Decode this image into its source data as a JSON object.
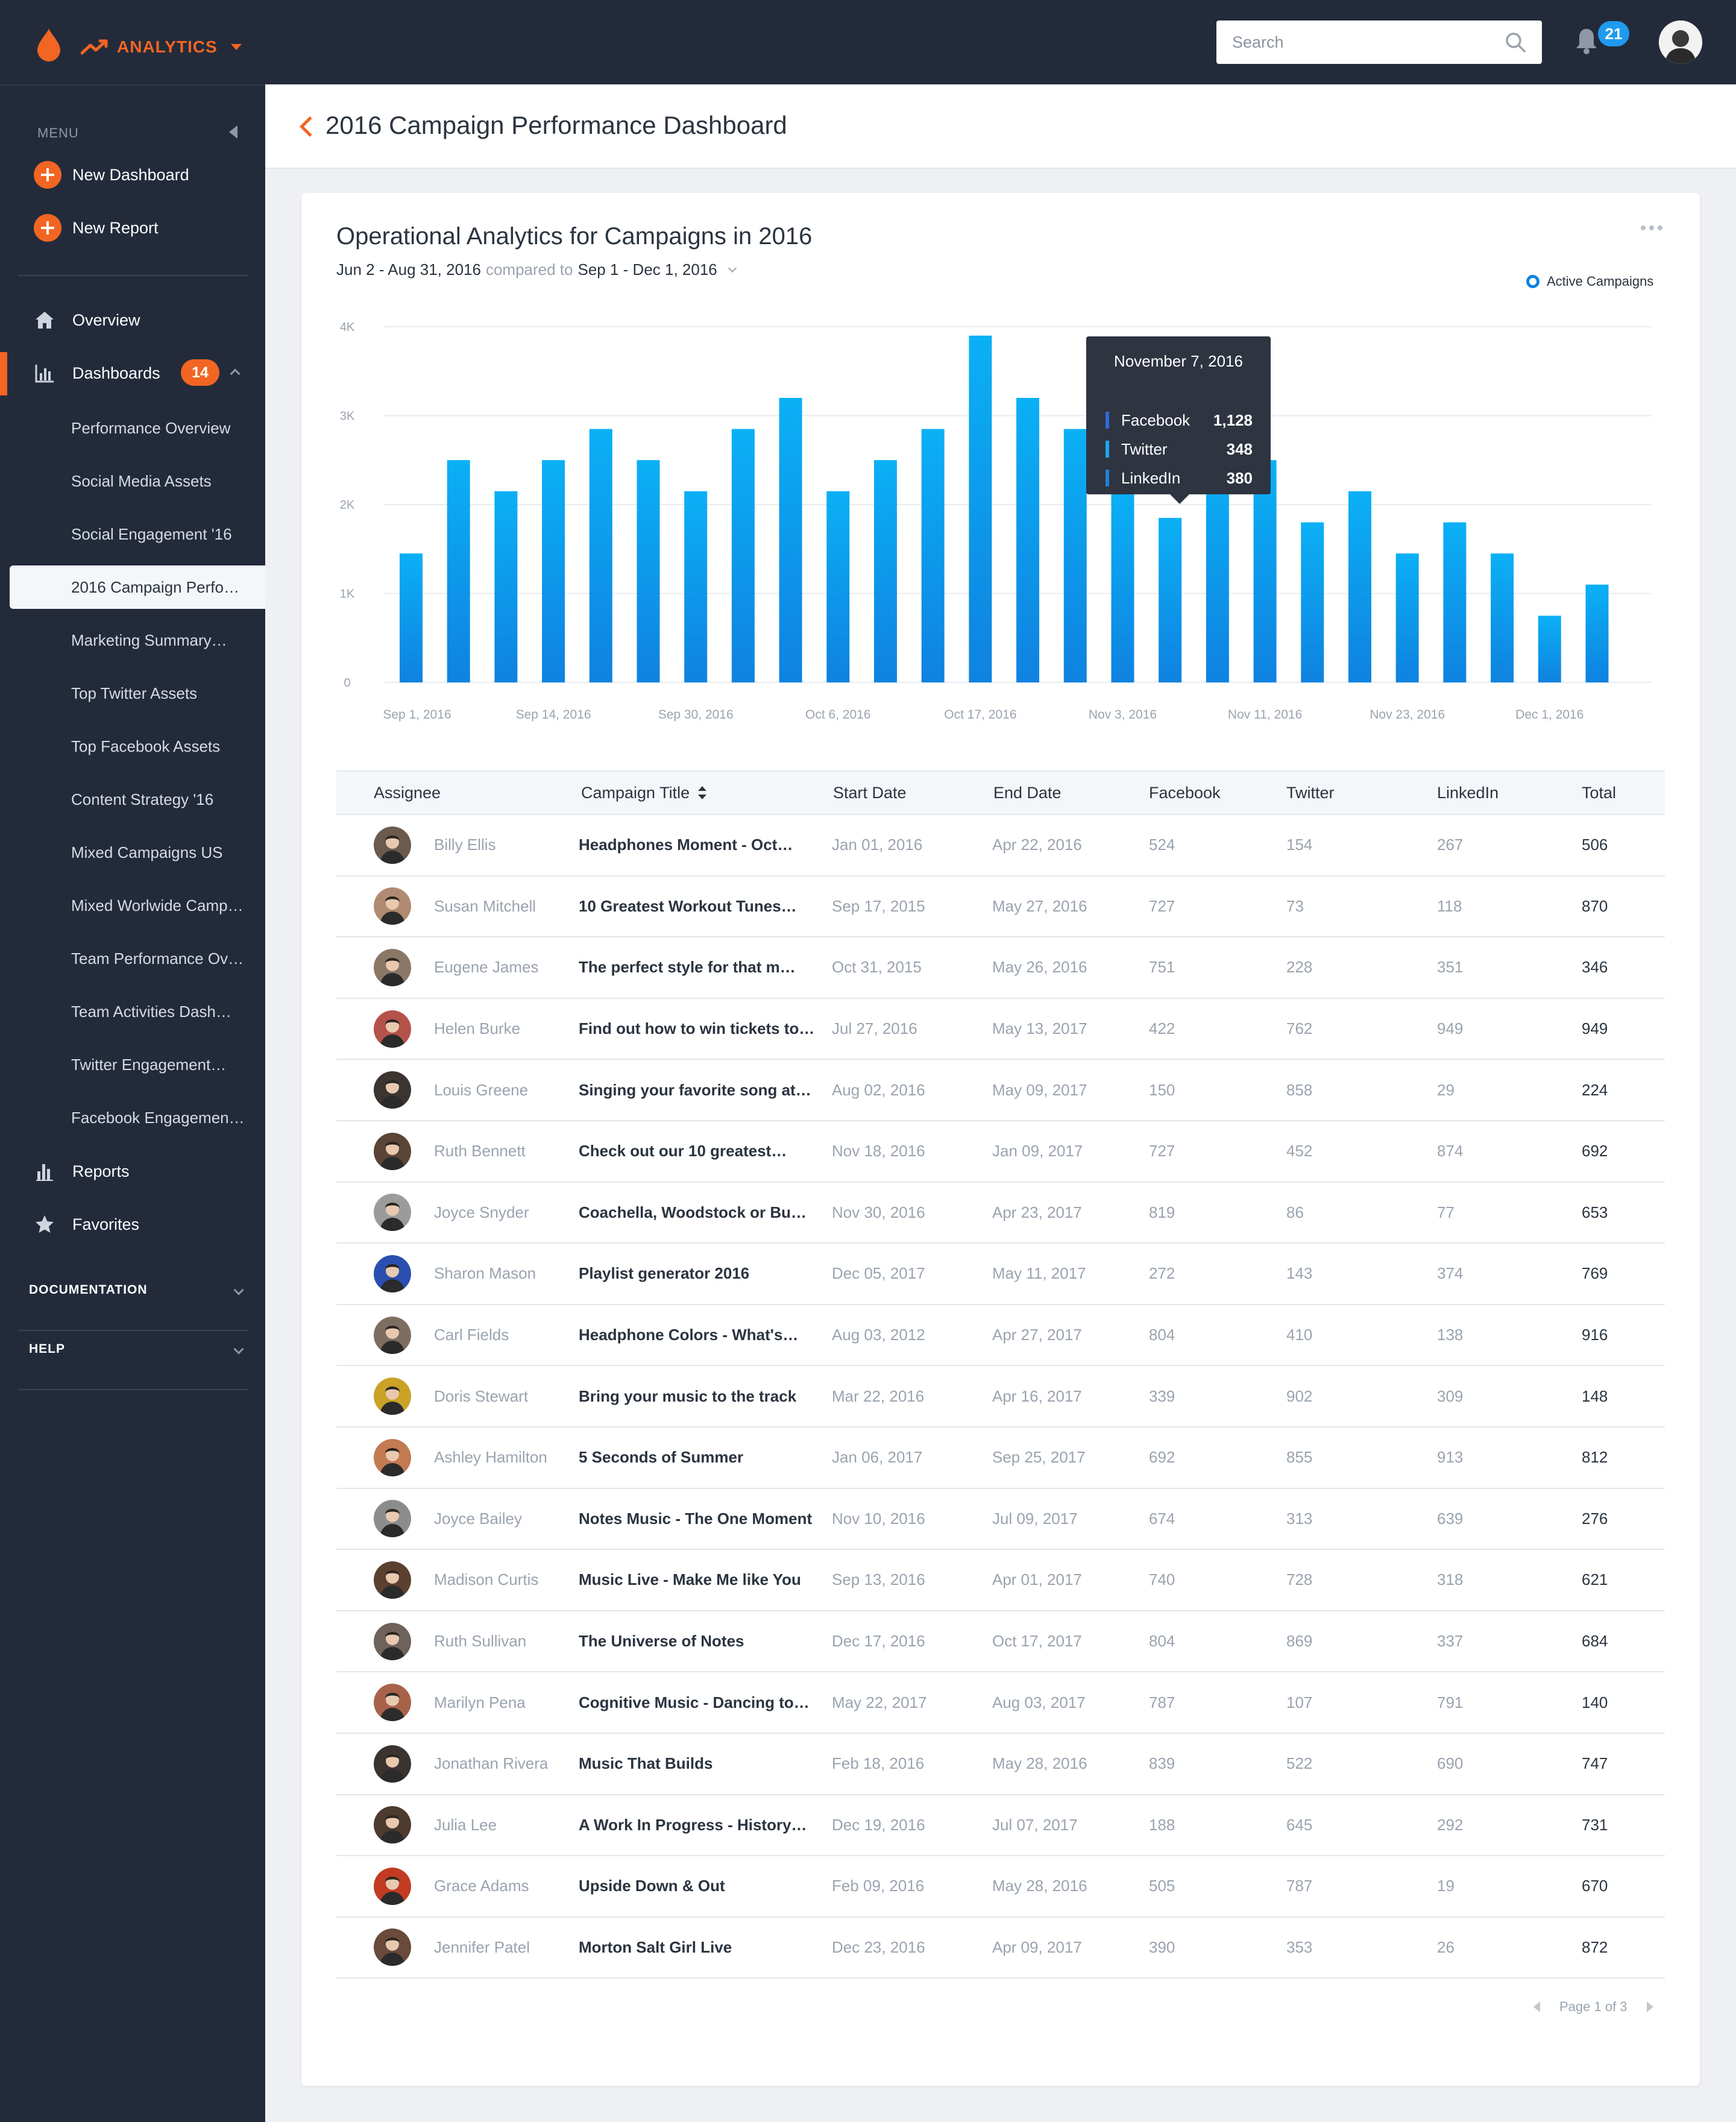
{
  "topbar": {
    "brand": "ANALYTICS",
    "search_placeholder": "Search",
    "notifications": "21"
  },
  "sidebar": {
    "menu_label": "MENU",
    "new_dashboard": "New Dashboard",
    "new_report": "New Report",
    "overview": "Overview",
    "dashboards": "Dashboards",
    "dashboards_count": "14",
    "dashboard_items": [
      "Performance Overview",
      "Social Media Assets",
      "Social Engagement '16",
      "2016 Campaign Perfo…",
      "Marketing Summary…",
      "Top Twitter Assets",
      "Top Facebook Assets",
      "Content Strategy '16",
      "Mixed Campaigns US",
      "Mixed Worlwide Camp…",
      "Team Performance Ov…",
      "Team Activities Dash…",
      "Twitter Engagement…",
      "Facebook Engagemen…"
    ],
    "active_item_index": 3,
    "reports": "Reports",
    "favorites": "Favorites",
    "documentation": "DOCUMENTATION",
    "help": "HELP"
  },
  "header": {
    "title": "2016 Campaign Performance Dashboard"
  },
  "card": {
    "title": "Operational Analytics for Campaigns in 2016",
    "range_primary": "Jun 2 - Aug 31, 2016",
    "compared_to": "compared to",
    "range_compare": "Sep 1 - Dec 1, 2016",
    "legend": "Active Campaigns"
  },
  "colors": {
    "accent": "#f26522",
    "bar_top": "#0bb0f5",
    "bar_bottom": "#0f82e0",
    "sidebar_bg": "#232b3b",
    "facebook": "#2e6bd6",
    "twitter": "#1ea6f0",
    "linkedin": "#1e82d6"
  },
  "chart_data": {
    "type": "bar",
    "y_ticks": [
      "0",
      "1K",
      "2K",
      "3K",
      "4K"
    ],
    "ylim": [
      0,
      4000
    ],
    "x_labels": [
      "Sep 1, 2016",
      "Sep 14, 2016",
      "Sep 30, 2016",
      "Oct 6, 2016",
      "Oct 17, 2016",
      "Nov 3, 2016",
      "Nov  11, 2016",
      "Nov 23, 2016",
      "Dec 1, 2016"
    ],
    "x_label_bar_index": [
      0,
      3,
      6,
      9,
      12,
      15,
      18,
      21,
      24
    ],
    "series": [
      {
        "name": "Active Campaigns",
        "values": [
          1450,
          2500,
          2150,
          2500,
          2850,
          2500,
          2150,
          2850,
          3200,
          2150,
          2500,
          2850,
          3900,
          3200,
          2850,
          2150,
          1850,
          2500,
          2500,
          1800,
          2150,
          1450,
          1800,
          1450,
          750,
          1100
        ]
      }
    ],
    "grid": true,
    "legend_position": "top-right",
    "tooltip": {
      "date": "November 7, 2016",
      "bar_index": 16,
      "rows": [
        {
          "name": "Facebook",
          "value": "1,128"
        },
        {
          "name": "Twitter",
          "value": "348"
        },
        {
          "name": "LinkedIn",
          "value": "380"
        }
      ]
    }
  },
  "table": {
    "headers": [
      "Assignee",
      "Campaign Title",
      "Start Date",
      "End Date",
      "Facebook",
      "Twitter",
      "LinkedIn",
      "Total"
    ],
    "rows": [
      {
        "assignee": "Billy Ellis",
        "title": "Headphones Moment - Oct…",
        "start": "Jan 01, 2016",
        "end": "Apr 22, 2016",
        "facebook": "524",
        "twitter": "154",
        "linkedin": "267",
        "total": "506",
        "avatar": "#6b5a4e"
      },
      {
        "assignee": "Susan Mitchell",
        "title": "10 Greatest Workout Tunes…",
        "start": "Sep 17, 2015",
        "end": "May 27, 2016",
        "facebook": "727",
        "twitter": "73",
        "linkedin": "118",
        "total": "870",
        "avatar": "#b08a72"
      },
      {
        "assignee": "Eugene James",
        "title": "The perfect style for that m…",
        "start": "Oct 31, 2015",
        "end": "May 26, 2016",
        "facebook": "751",
        "twitter": "228",
        "linkedin": "351",
        "total": "346",
        "avatar": "#8a7766"
      },
      {
        "assignee": "Helen Burke",
        "title": "Find out how to win tickets to…",
        "start": "Jul 27, 2016",
        "end": "May 13, 2017",
        "facebook": "422",
        "twitter": "762",
        "linkedin": "949",
        "total": "949",
        "avatar": "#b5524a"
      },
      {
        "assignee": "Louis Greene",
        "title": "Singing your favorite song at…",
        "start": "Aug 02, 2016",
        "end": "May 09, 2017",
        "facebook": "150",
        "twitter": "858",
        "linkedin": "29",
        "total": "224",
        "avatar": "#3c3431"
      },
      {
        "assignee": "Ruth Bennett",
        "title": "Check out our 10 greatest…",
        "start": "Nov 18, 2016",
        "end": "Jan 09, 2017",
        "facebook": "727",
        "twitter": "452",
        "linkedin": "874",
        "total": "692",
        "avatar": "#5a4436"
      },
      {
        "assignee": "Joyce Snyder",
        "title": "Coachella, Woodstock or Bu…",
        "start": "Nov 30, 2016",
        "end": "Apr 23, 2017",
        "facebook": "819",
        "twitter": "86",
        "linkedin": "77",
        "total": "653",
        "avatar": "#9b9b9b"
      },
      {
        "assignee": "Sharon Mason",
        "title": "Playlist generator 2016",
        "start": "Dec 05, 2017",
        "end": "May 11, 2017",
        "facebook": "272",
        "twitter": "143",
        "linkedin": "374",
        "total": "769",
        "avatar": "#2a4fb0"
      },
      {
        "assignee": "Carl Fields",
        "title": "Headphone Colors - What's…",
        "start": "Aug 03, 2012",
        "end": "Apr 27, 2017",
        "facebook": "804",
        "twitter": "410",
        "linkedin": "138",
        "total": "916",
        "avatar": "#7d6e62"
      },
      {
        "assignee": "Doris Stewart",
        "title": "Bring your music to the track",
        "start": "Mar 22, 2016",
        "end": "Apr 16, 2017",
        "facebook": "339",
        "twitter": "902",
        "linkedin": "309",
        "total": "148",
        "avatar": "#c9a227"
      },
      {
        "assignee": "Ashley Hamilton",
        "title": "5 Seconds of Summer",
        "start": "Jan 06, 2017",
        "end": "Sep 25, 2017",
        "facebook": "692",
        "twitter": "855",
        "linkedin": "913",
        "total": "812",
        "avatar": "#c47a52"
      },
      {
        "assignee": "Joyce Bailey",
        "title": "Notes Music - The One Moment",
        "start": "Nov 10, 2016",
        "end": "Jul 09, 2017",
        "facebook": "674",
        "twitter": "313",
        "linkedin": "639",
        "total": "276",
        "avatar": "#8c8c8c"
      },
      {
        "assignee": "Madison Curtis",
        "title": "Music Live - Make Me like You",
        "start": "Sep 13, 2016",
        "end": "Apr 01, 2017",
        "facebook": "740",
        "twitter": "728",
        "linkedin": "318",
        "total": "621",
        "avatar": "#5b4030"
      },
      {
        "assignee": "Ruth Sullivan",
        "title": "The Universe of Notes",
        "start": "Dec 17, 2016",
        "end": "Oct 17, 2017",
        "facebook": "804",
        "twitter": "869",
        "linkedin": "337",
        "total": "684",
        "avatar": "#6e625a"
      },
      {
        "assignee": "Marilyn Pena",
        "title": "Cognitive Music - Dancing to…",
        "start": "May 22, 2017",
        "end": "Aug 03, 2017",
        "facebook": "787",
        "twitter": "107",
        "linkedin": "791",
        "total": "140",
        "avatar": "#a8624a"
      },
      {
        "assignee": "Jonathan Rivera",
        "title": "Music That Builds",
        "start": "Feb 18, 2016",
        "end": "May 28, 2016",
        "facebook": "839",
        "twitter": "522",
        "linkedin": "690",
        "total": "747",
        "avatar": "#3a3330"
      },
      {
        "assignee": "Julia Lee",
        "title": "A Work In Progress - History…",
        "start": "Dec 19, 2016",
        "end": "Jul 07, 2017",
        "facebook": "188",
        "twitter": "645",
        "linkedin": "292",
        "total": "731",
        "avatar": "#4d3b30"
      },
      {
        "assignee": "Grace Adams",
        "title": "Upside Down & Out",
        "start": "Feb 09, 2016",
        "end": "May 28, 2016",
        "facebook": "505",
        "twitter": "787",
        "linkedin": "19",
        "total": "670",
        "avatar": "#c23b22"
      },
      {
        "assignee": "Jennifer Patel",
        "title": "Morton Salt Girl Live",
        "start": "Dec 23, 2016",
        "end": "Apr 09, 2017",
        "facebook": "390",
        "twitter": "353",
        "linkedin": "26",
        "total": "872",
        "avatar": "#6a4a3a"
      }
    ]
  },
  "pager": {
    "label": "Page 1 of 3"
  }
}
